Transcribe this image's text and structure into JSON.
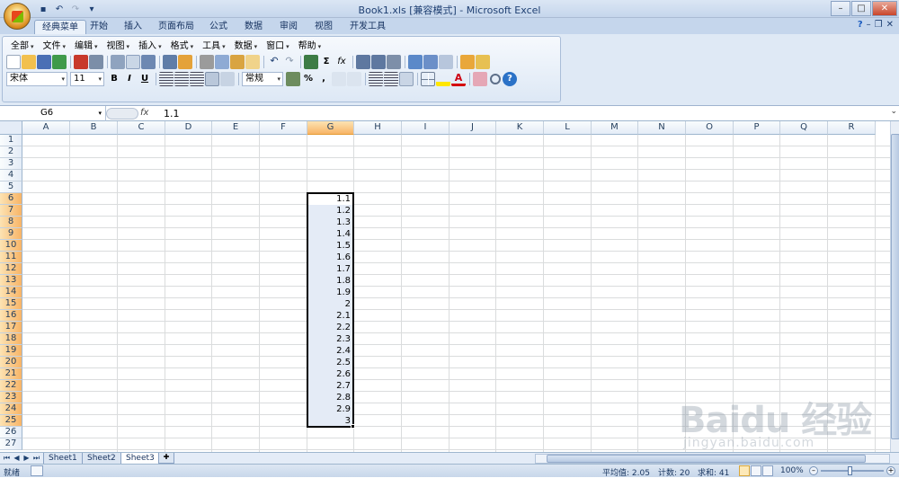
{
  "window": {
    "title": "Book1.xls  [兼容模式] - Microsoft Excel",
    "controls": [
      "–",
      "□",
      "✕"
    ]
  },
  "ribbon_tabs": [
    {
      "label": "经典菜单",
      "active": true
    },
    {
      "label": "开始"
    },
    {
      "label": "插入"
    },
    {
      "label": "页面布局"
    },
    {
      "label": "公式"
    },
    {
      "label": "数据"
    },
    {
      "label": "审阅"
    },
    {
      "label": "视图"
    },
    {
      "label": "开发工具"
    }
  ],
  "menus": [
    "全部",
    "文件",
    "编辑",
    "视图",
    "插入",
    "格式",
    "工具",
    "数据",
    "窗口",
    "帮助"
  ],
  "toolbar": {
    "font_name": "宋体",
    "font_size": "11",
    "bold": "B",
    "italic": "I",
    "underline": "U",
    "number_format": "常规",
    "percent": "%",
    "comma": ",",
    "sigma": "Σ",
    "fx": "fx"
  },
  "formula_bar": {
    "name_box": "G6",
    "fx_label": "fx",
    "value": "1.1"
  },
  "grid": {
    "columns": [
      "A",
      "B",
      "C",
      "D",
      "E",
      "F",
      "G",
      "H",
      "I",
      "J",
      "K",
      "L",
      "M",
      "N",
      "O",
      "P",
      "Q",
      "R"
    ],
    "rows": [
      "1",
      "2",
      "3",
      "4",
      "5",
      "6",
      "7",
      "8",
      "9",
      "10",
      "11",
      "12",
      "13",
      "14",
      "15",
      "16",
      "17",
      "18",
      "19",
      "20",
      "21",
      "22",
      "23",
      "24",
      "25",
      "26",
      "27"
    ],
    "selected_column": "G",
    "selected_rows_from": 6,
    "selected_rows_to": 25,
    "g_values": [
      "1.1",
      "1.2",
      "1.3",
      "1.4",
      "1.5",
      "1.6",
      "1.7",
      "1.8",
      "1.9",
      "2",
      "2.1",
      "2.2",
      "2.3",
      "2.4",
      "2.5",
      "2.6",
      "2.7",
      "2.8",
      "2.9",
      "3"
    ]
  },
  "sheets": [
    {
      "label": "Sheet1"
    },
    {
      "label": "Sheet2"
    },
    {
      "label": "Sheet3",
      "active": true
    }
  ],
  "status": {
    "ready": "就绪",
    "average": "平均值: 2.05",
    "count": "计数: 20",
    "sum": "求和: 41",
    "zoom": "100%"
  },
  "watermark": {
    "logo": "Baidu 经验",
    "url": "jingyan.baidu.com"
  },
  "colors": {
    "selected_header": "#f8b466",
    "selection_fill": "#e4ebf6",
    "header_bg": "#e4ecf7"
  }
}
